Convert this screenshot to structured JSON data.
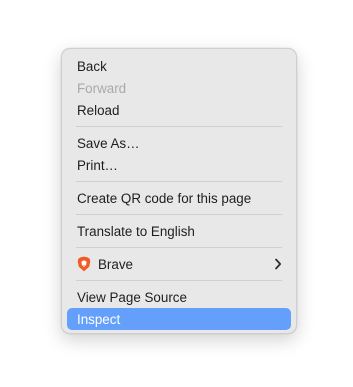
{
  "menu": {
    "items": [
      {
        "label": "Back"
      },
      {
        "label": "Forward",
        "disabled": true
      },
      {
        "label": "Reload"
      },
      {
        "label": "Save As…"
      },
      {
        "label": "Print…"
      },
      {
        "label": "Create QR code for this page"
      },
      {
        "label": "Translate to English"
      },
      {
        "label": "Brave",
        "icon": "brave-lion-icon",
        "submenu_icon": "chevron-right-icon"
      },
      {
        "label": "View Page Source"
      },
      {
        "label": "Inspect",
        "highlighted": true
      }
    ]
  },
  "colors": {
    "menu_background": "#e8e8e8",
    "highlight": "#64a0fb",
    "disabled_text": "#a9a9a9",
    "brave_orange": "#f15a22"
  }
}
